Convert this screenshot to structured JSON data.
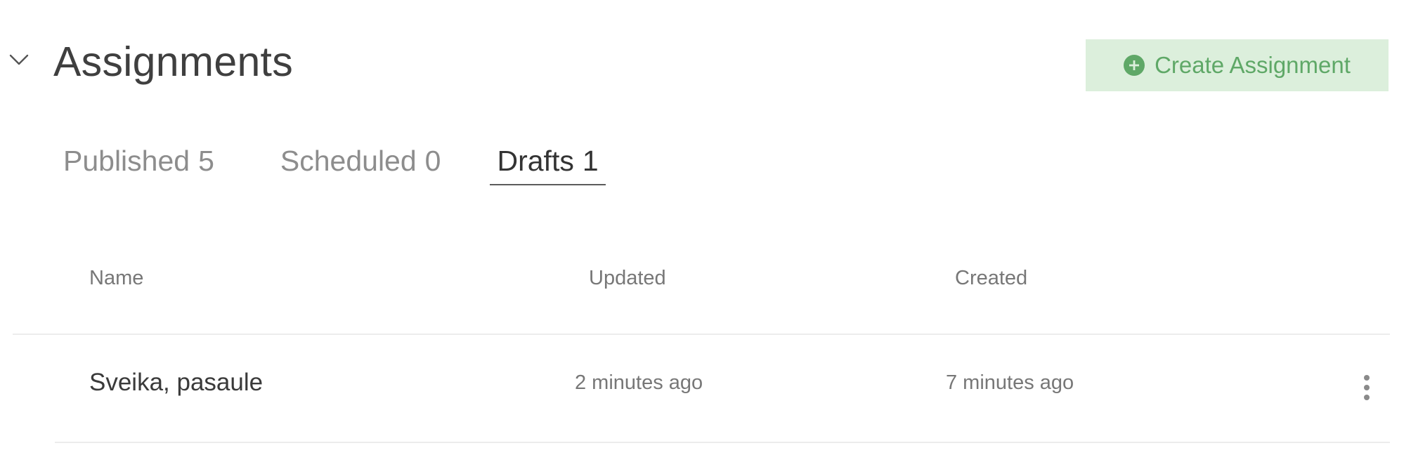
{
  "header": {
    "title": "Assignments",
    "create_button_label": "Create Assignment"
  },
  "tabs": [
    {
      "label": "Published",
      "count": "5",
      "active": false
    },
    {
      "label": "Scheduled",
      "count": "0",
      "active": false
    },
    {
      "label": "Drafts",
      "count": "1",
      "active": true
    }
  ],
  "table": {
    "columns": [
      "Name",
      "Updated",
      "Created"
    ],
    "rows": [
      {
        "name": "Sveika, pasaule",
        "updated": "2 minutes ago",
        "created": "7 minutes ago"
      }
    ]
  },
  "icons": {
    "collapse": "chevron-down-icon",
    "create": "plus-circle-icon",
    "row_menu": "kebab-menu-icon"
  },
  "colors": {
    "accent_green": "#5fa867",
    "button_bg": "#dcefdc",
    "title_text": "#3f3f3f",
    "muted_text": "#8d8d8d"
  }
}
